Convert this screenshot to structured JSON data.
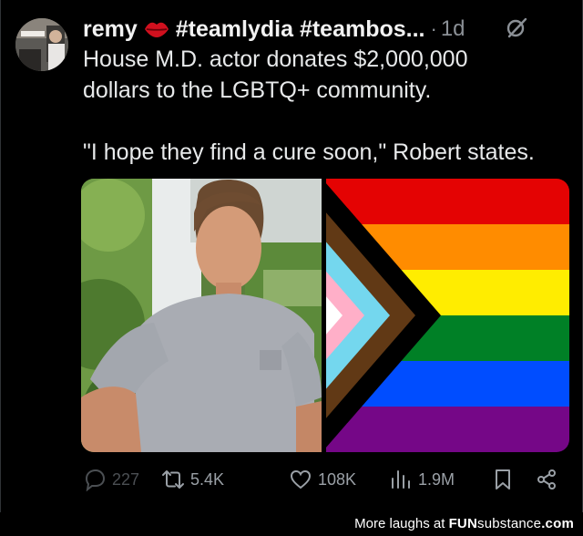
{
  "post": {
    "author": {
      "display_name": "remy",
      "badge_icon": "lips-icon",
      "hashtags": "#teamlydia #teambos..."
    },
    "separator": "·",
    "time": "1d",
    "text_lines": [
      "House M.D. actor donates $2,000,000",
      "dollars to the LGBTQ+ community.",
      "\"I hope they find a cure soon,\" Robert states."
    ]
  },
  "actions": {
    "reply_count": "227",
    "retweet_count": "5.4K",
    "like_count": "108K",
    "views_count": "1.9M"
  },
  "watermark": {
    "lead": "More laughs at",
    "brand": "FUN",
    "brand_sub": "substance",
    "suffix": ".com"
  },
  "colors": {
    "background": "#000000",
    "text": "#e7e9ea",
    "muted": "#9aa0a6",
    "dim": "#4b4f53"
  },
  "flag_stripes": [
    "#e40303",
    "#ff8c00",
    "#ffed00",
    "#008026",
    "#004dff",
    "#750787"
  ]
}
